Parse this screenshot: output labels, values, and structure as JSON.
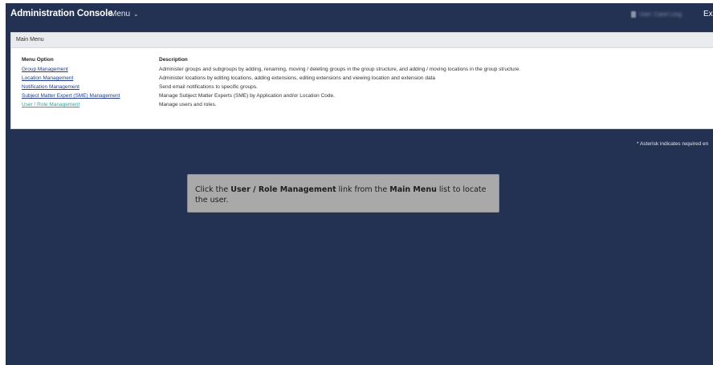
{
  "header": {
    "app_title": "Administration Console",
    "menu_label": "Menu",
    "menu_caret": "⌄",
    "user_name": "User: Carol Long",
    "exit_label": "Exi"
  },
  "main_menu": {
    "title": "Main Menu",
    "column_option": "Menu Option",
    "column_description": "Description",
    "items": [
      {
        "label": "Group Management",
        "description": "Administer groups and subgroups by adding, renaming, moving / deleting groups in the group structure, and adding / moving locations in the group structure."
      },
      {
        "label": "Location Management",
        "description": "Administer locations by editing locations, adding extensions, editing extensions and viewing location and extension data"
      },
      {
        "label": "Notification Management",
        "description": "Send email notifications to specific groups."
      },
      {
        "label": "Subject Matter Expert (SME) Management",
        "description": "Manage Subject Matter Experts (SME) by Application and/or Location Code."
      },
      {
        "label": "User / Role Management",
        "description": "Manage users and roles."
      }
    ]
  },
  "asterisk_note": "* Asterisk indicates required en",
  "callout": {
    "part1": "Click the ",
    "bold1": "User / Role Management",
    "part2": " link from the ",
    "bold2": "Main Menu",
    "part3": " list to locate the user."
  },
  "colors": {
    "background": "#233253",
    "link": "#1f3b8a",
    "active_link": "#2aa79b",
    "callout_bg": "#a9a9a9"
  }
}
